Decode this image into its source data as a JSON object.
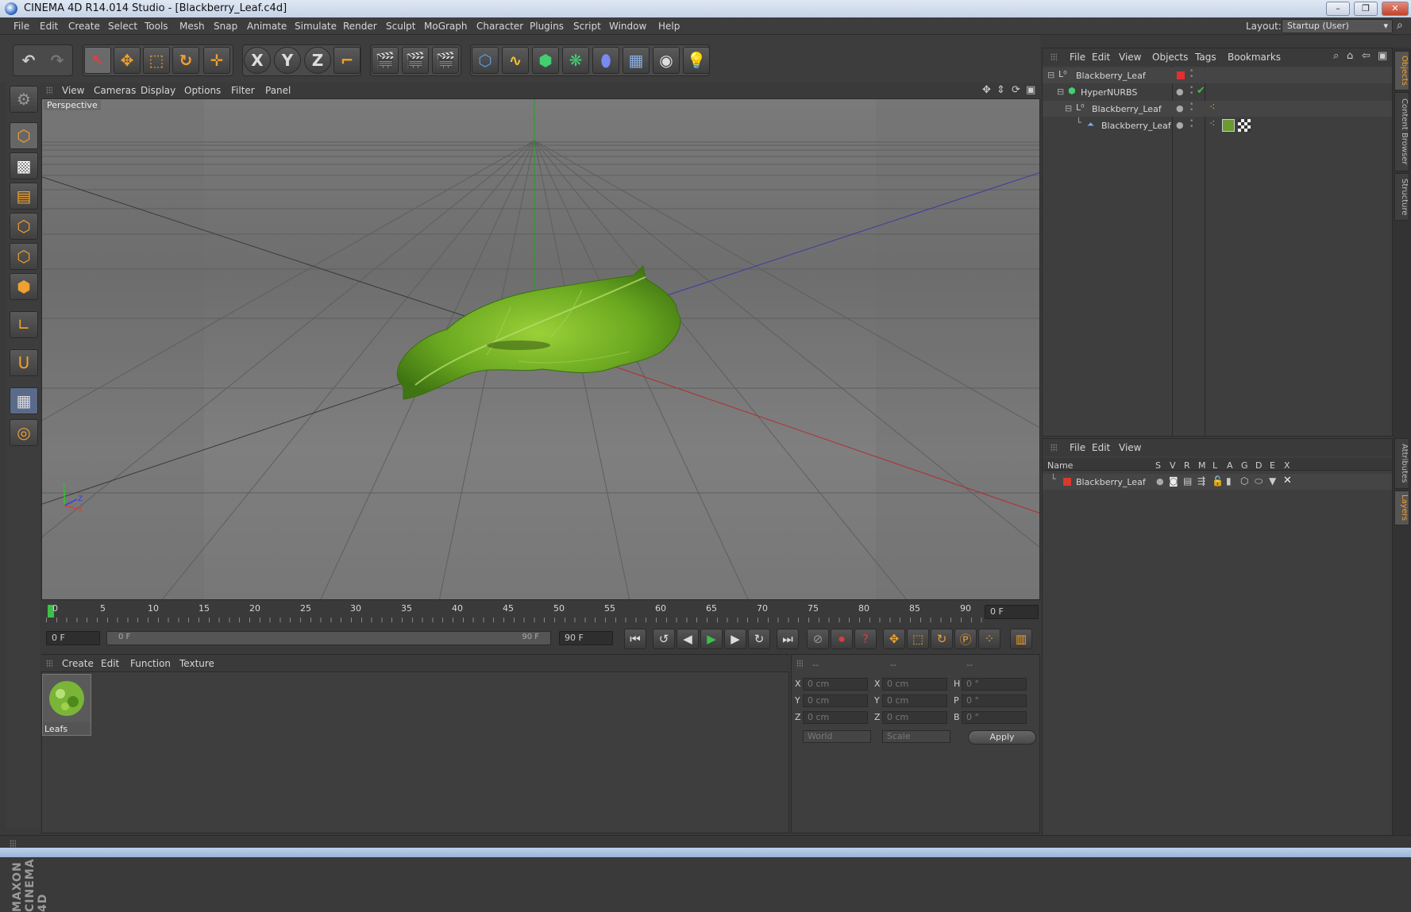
{
  "window": {
    "title": "CINEMA 4D R14.014 Studio - [Blackberry_Leaf.c4d]",
    "controls": [
      "–",
      "❐",
      "✕"
    ]
  },
  "menubar": {
    "items": [
      "File",
      "Edit",
      "Create",
      "Select",
      "Tools",
      "Mesh",
      "Snap",
      "Animate",
      "Simulate",
      "Render",
      "Sculpt",
      "MoGraph",
      "Character",
      "Plugins",
      "Script",
      "Window",
      "Help"
    ],
    "layout_label": "Layout:",
    "layout_value": "Startup (User)"
  },
  "toolbar": {
    "axis_buttons": [
      "X",
      "Y",
      "Z"
    ]
  },
  "viewport": {
    "menu": [
      "View",
      "Cameras",
      "Display",
      "Options",
      "Filter",
      "Panel"
    ],
    "view_label": "Perspective",
    "axis_labels": {
      "y": "Y",
      "x": "X",
      "z": "Z"
    }
  },
  "timeline": {
    "ticks": [
      "0",
      "5",
      "10",
      "15",
      "20",
      "25",
      "30",
      "35",
      "40",
      "45",
      "50",
      "55",
      "60",
      "65",
      "70",
      "75",
      "80",
      "85",
      "90"
    ],
    "current_frame": "0 F",
    "start_frame": "0 F",
    "range_start": "0 F",
    "range_end": "90 F",
    "end_frame": "90 F"
  },
  "material_manager": {
    "menu": [
      "Create",
      "Edit",
      "Function",
      "Texture"
    ],
    "materials": [
      {
        "name": "Leafs"
      }
    ]
  },
  "coordinates": {
    "headers": [
      "--",
      "--",
      "--"
    ],
    "rows": [
      {
        "l1": "X",
        "v1": "0 cm",
        "l2": "X",
        "v2": "0 cm",
        "l3": "H",
        "v3": "0 °"
      },
      {
        "l1": "Y",
        "v1": "0 cm",
        "l2": "Y",
        "v2": "0 cm",
        "l3": "P",
        "v3": "0 °"
      },
      {
        "l1": "Z",
        "v1": "0 cm",
        "l2": "Z",
        "v2": "0 cm",
        "l3": "B",
        "v3": "0 °"
      }
    ],
    "mode_select": "World",
    "scale_select": "Scale",
    "apply": "Apply"
  },
  "object_manager": {
    "menu": [
      "File",
      "Edit",
      "View",
      "Objects",
      "Tags",
      "Bookmarks"
    ],
    "objects": [
      {
        "name": "Blackberry_Leaf",
        "indent": 0
      },
      {
        "name": "HyperNURBS",
        "indent": 1
      },
      {
        "name": "Blackberry_Leaf",
        "indent": 2
      },
      {
        "name": "Blackberry_Leaf",
        "indent": 3
      }
    ]
  },
  "layer_manager": {
    "menu": [
      "File",
      "Edit",
      "View"
    ],
    "columns": [
      "Name",
      "S",
      "V",
      "R",
      "M",
      "L",
      "A",
      "G",
      "D",
      "E",
      "X"
    ],
    "layers": [
      {
        "name": "Blackberry_Leaf",
        "color": "#d93a2f"
      }
    ]
  },
  "side_tabs": [
    "Objects",
    "Content Browser",
    "Structure",
    "Attributes",
    "Layers"
  ],
  "branding": "MAXON CINEMA 4D",
  "colors": {
    "accent_orange": "#f0a030",
    "leaf_green": "#7ab32a",
    "axis_red": "#b03030",
    "axis_blue": "#3a3aa8",
    "axis_green": "#2a9a2a"
  }
}
